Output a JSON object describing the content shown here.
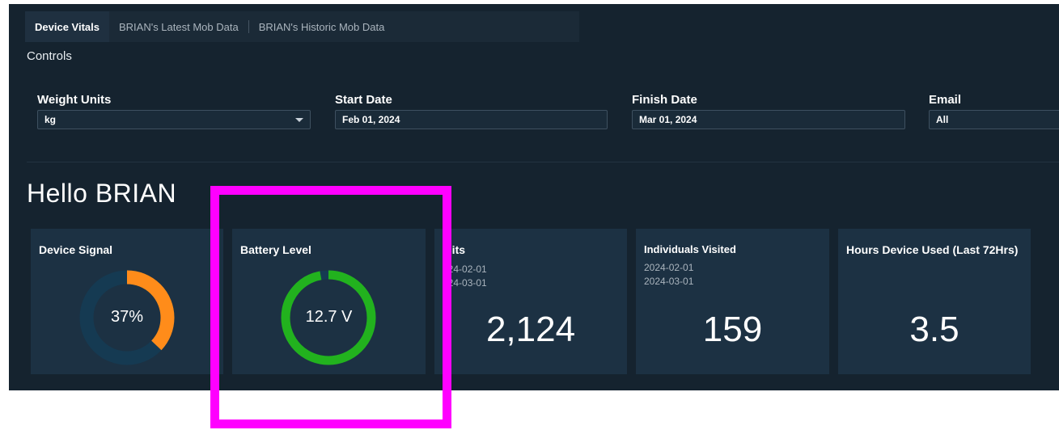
{
  "tabs": [
    {
      "label": "Device Vitals",
      "active": true
    },
    {
      "label": "BRIAN's Latest Mob Data",
      "active": false
    },
    {
      "label": "BRIAN's Historic Mob Data",
      "active": false
    }
  ],
  "controls": {
    "title": "Controls",
    "weight_units": {
      "label": "Weight Units",
      "value": "kg"
    },
    "start_date": {
      "label": "Start Date",
      "value": "Feb 01, 2024"
    },
    "finish_date": {
      "label": "Finish Date",
      "value": "Mar 01, 2024"
    },
    "email": {
      "label": "Email",
      "value": "All"
    }
  },
  "greeting": "Hello BRIAN",
  "cards": {
    "device_signal": {
      "title": "Device Signal",
      "value_text": "37%",
      "fraction": 0.37,
      "color": "#ff8c1a",
      "track_color": "#153a52"
    },
    "battery_level": {
      "title": "Battery Level",
      "value_text": "12.7 V",
      "fraction": 0.97,
      "color": "#22b21e",
      "track_color": "#153a52"
    },
    "visits": {
      "title": "isits",
      "date_from": "024-02-01",
      "date_to": "024-03-01",
      "value": "2,124"
    },
    "individuals_visited": {
      "title": "Individuals Visited",
      "date_from": "2024-02-01",
      "date_to": "2024-03-01",
      "value": "159"
    },
    "hours_used": {
      "title": "Hours Device Used (Last 72Hrs)",
      "value": "3.5"
    }
  },
  "highlight_color": "#ff00ff"
}
